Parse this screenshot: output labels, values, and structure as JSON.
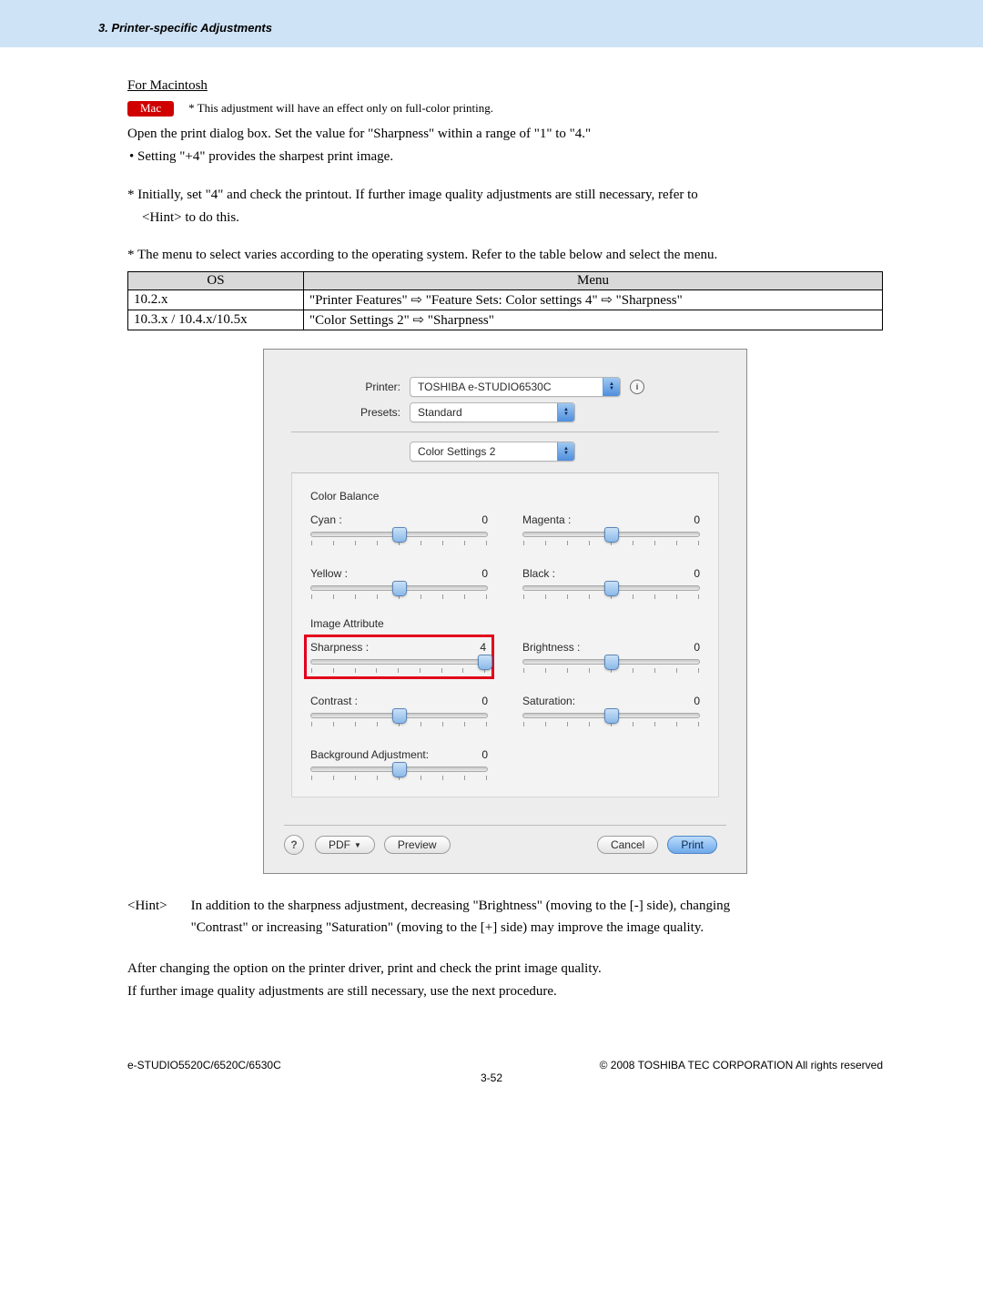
{
  "header": {
    "chapter": "3. Printer-specific Adjustments"
  },
  "section": {
    "title": "For Macintosh",
    "mac_badge": "Mac",
    "mac_note": "* This adjustment will have an effect only on full-color printing.",
    "p1": "Open the print dialog box.  Set the value for \"Sharpness\" within a range of \"1\" to \"4.\"",
    "p2": "• Setting \"+4\" provides the sharpest print image.",
    "p3": "* Initially, set \"4\" and check the printout.  If further image quality adjustments are still necessary, refer to",
    "p3b": "<Hint> to do this.",
    "p4": "* The menu to select varies according to the operating system.  Refer to the table below and select the menu."
  },
  "table": {
    "h1": "OS",
    "h2": "Menu",
    "rows": [
      {
        "os": "10.2.x",
        "menu": "\"Printer Features\" ⇨ \"Feature Sets: Color settings 4\" ⇨ \"Sharpness\""
      },
      {
        "os": "10.3.x / 10.4.x/10.5x",
        "menu": "\"Color Settings 2\" ⇨ \"Sharpness\""
      }
    ]
  },
  "dialog": {
    "printer_label": "Printer:",
    "printer_value": "TOSHIBA e-STUDIO6530C",
    "presets_label": "Presets:",
    "presets_value": "Standard",
    "pane_value": "Color Settings 2",
    "section_balance": "Color Balance",
    "section_attr": "Image Attribute",
    "sliders": {
      "cyan": {
        "label": "Cyan :",
        "value": "0",
        "pos": 50
      },
      "magenta": {
        "label": "Magenta :",
        "value": "0",
        "pos": 50
      },
      "yellow": {
        "label": "Yellow :",
        "value": "0",
        "pos": 50
      },
      "black": {
        "label": "Black :",
        "value": "0",
        "pos": 50
      },
      "sharpness": {
        "label": "Sharpness :",
        "value": "4",
        "pos": 100
      },
      "brightness": {
        "label": "Brightness :",
        "value": "0",
        "pos": 50
      },
      "contrast": {
        "label": "Contrast :",
        "value": "0",
        "pos": 50
      },
      "saturation": {
        "label": "Saturation:",
        "value": "0",
        "pos": 50
      },
      "bg": {
        "label": "Background Adjustment:",
        "value": "0",
        "pos": 50
      }
    },
    "buttons": {
      "help": "?",
      "pdf": "PDF",
      "preview": "Preview",
      "cancel": "Cancel",
      "print": "Print"
    }
  },
  "hint": {
    "label": "<Hint>",
    "text1": "In addition to the sharpness adjustment, decreasing \"Brightness\" (moving to the [-] side), changing",
    "text2": "\"Contrast\" or increasing \"Saturation\" (moving to the [+] side) may improve the image quality."
  },
  "closing": {
    "l1": "After changing the option on the printer driver, print and check the print image quality.",
    "l2": "If further image quality adjustments are still necessary, use the next procedure."
  },
  "footer": {
    "left": "e-STUDIO5520C/6520C/6530C",
    "right": "© 2008 TOSHIBA TEC CORPORATION All rights reserved",
    "page": "3-52"
  }
}
